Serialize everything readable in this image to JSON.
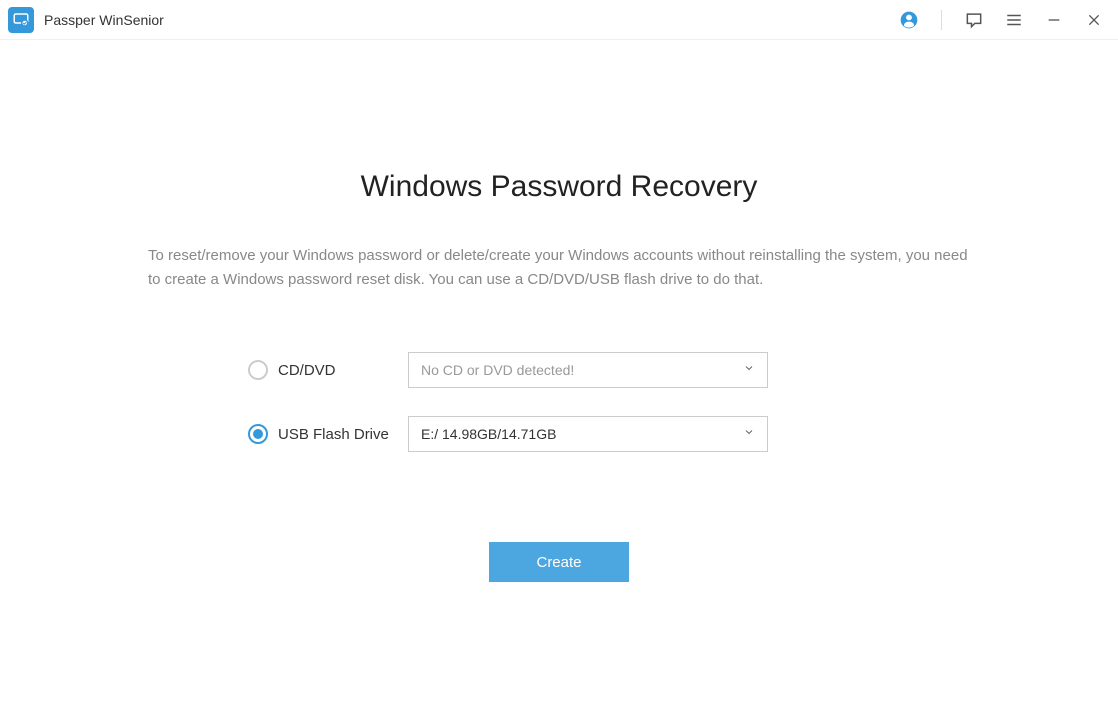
{
  "header": {
    "app_title": "Passper WinSenior"
  },
  "main": {
    "title": "Windows Password Recovery",
    "description": "To reset/remove your Windows password or delete/create your Windows accounts without reinstalling the system, you need to create a Windows password reset disk. You can use a CD/DVD/USB flash drive to do that.",
    "options": {
      "cd_dvd": {
        "label": "CD/DVD",
        "selected": false,
        "value": "No CD or DVD detected!"
      },
      "usb": {
        "label": "USB Flash Drive",
        "selected": true,
        "value": "E:/ 14.98GB/14.71GB"
      }
    },
    "create_button": "Create"
  }
}
